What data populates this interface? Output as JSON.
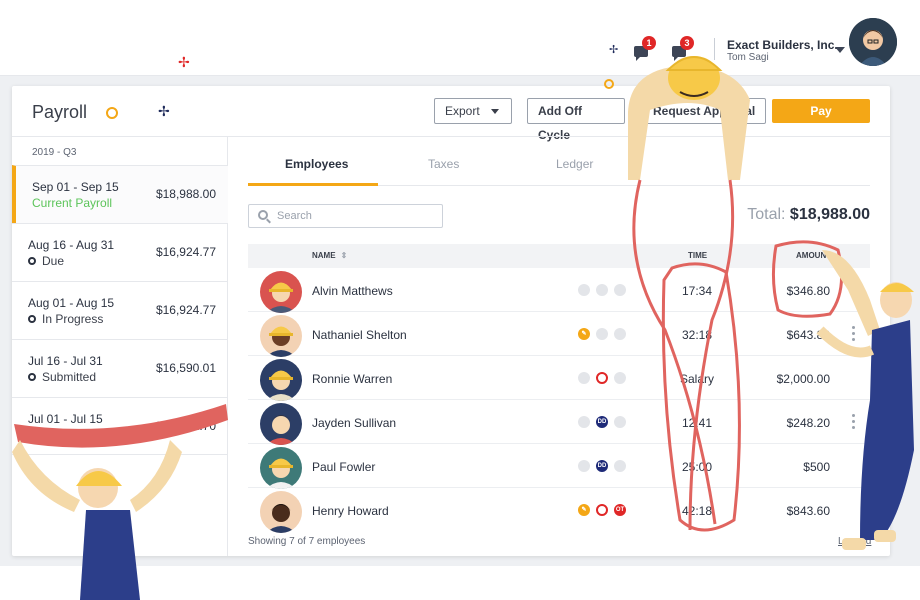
{
  "header": {
    "notifications": [
      {
        "icon": "chat-icon",
        "count": "1"
      },
      {
        "icon": "bell-icon",
        "count": "3"
      }
    ],
    "company": "Exact Builders, Inc.",
    "user": "Tom Sagi"
  },
  "page": {
    "title": "Payroll",
    "buttons": {
      "export": "Export",
      "add_off_cycle": "Add Off Cycle",
      "request_approval": "Request Approval",
      "pay": "Pay"
    },
    "accent_color": "#f4a716"
  },
  "sidebar": {
    "quarter": "2019 - Q3",
    "periods": [
      {
        "dates": "Sep 01 - Sep 15",
        "status": "Current Payroll",
        "amount": "$18,988.00"
      },
      {
        "dates": "Aug 16 - Aug 31",
        "status": "Due",
        "amount": "$16,924.77"
      },
      {
        "dates": "Aug 01 - Aug 15",
        "status": "In Progress",
        "amount": "$16,924.77"
      },
      {
        "dates": "Jul 16 - Jul 31",
        "status": "Submitted",
        "amount": "$16,590.01"
      },
      {
        "dates": "Jul 01 - Jul 15",
        "status": "Paid",
        "amount": "$14,421.70"
      }
    ]
  },
  "tabs": [
    "Employees",
    "Taxes",
    "Ledger"
  ],
  "search": {
    "placeholder": "Search"
  },
  "total": {
    "label": "Total:",
    "value": "$18,988.00"
  },
  "table": {
    "columns": {
      "name": "NAME",
      "time": "TIME",
      "amount": "AMOUNT"
    },
    "rows": [
      {
        "name": "Alvin Matthews",
        "time": "17:34",
        "amount": "$346.80"
      },
      {
        "name": "Nathaniel Shelton",
        "time": "32:18",
        "amount": "$643.80"
      },
      {
        "name": "Ronnie Warren",
        "time": "Salary",
        "amount": "$2,000.00"
      },
      {
        "name": "Jayden Sullivan",
        "time": "12:41",
        "amount": "$248.20"
      },
      {
        "name": "Paul Fowler",
        "time": "25:00",
        "amount": "$500"
      },
      {
        "name": "Henry Howard",
        "time": "42:18",
        "amount": "$843.60"
      }
    ],
    "badges": {
      "dd": "DD",
      "ot": "OT"
    },
    "footer": "Showing 7 of 7 employees",
    "legend": "Legend"
  }
}
